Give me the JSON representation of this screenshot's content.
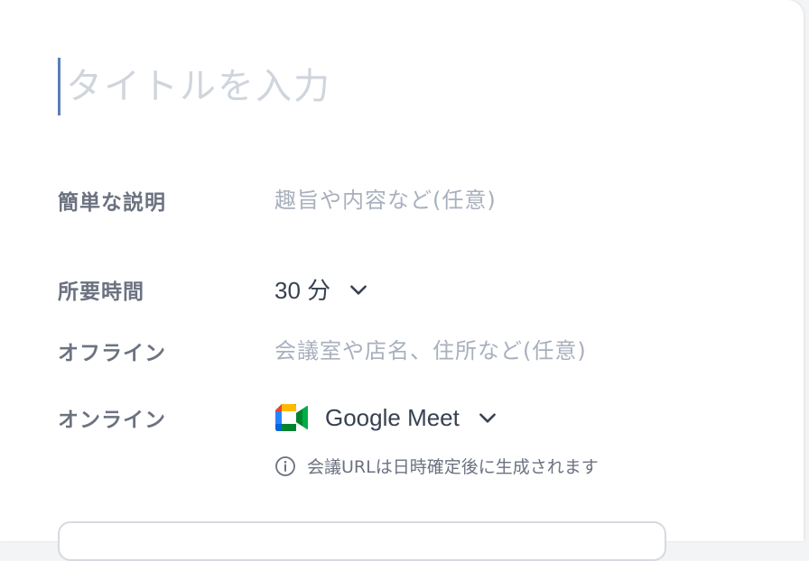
{
  "title": {
    "placeholder": "タイトルを入力",
    "value": ""
  },
  "fields": {
    "description": {
      "label": "簡単な説明",
      "placeholder": "趣旨や内容など(任意)"
    },
    "duration": {
      "label": "所要時間",
      "value": "30 分"
    },
    "offline": {
      "label": "オフライン",
      "placeholder": "会議室や店名、住所など(任意)"
    },
    "online": {
      "label": "オンライン",
      "value": "Google Meet",
      "hint": "会議URLは日時確定後に生成されます"
    }
  },
  "icons": {
    "chevron": "chevron-down-icon",
    "meet": "google-meet-icon",
    "info": "info-icon"
  },
  "colors": {
    "caret": "#5a7fb8",
    "label": "#6b7280",
    "placeholder": "#a8b0bd",
    "meet_green": "#00832d",
    "meet_blue": "#0066da",
    "meet_red": "#e94235",
    "meet_yellow": "#ffba00"
  }
}
